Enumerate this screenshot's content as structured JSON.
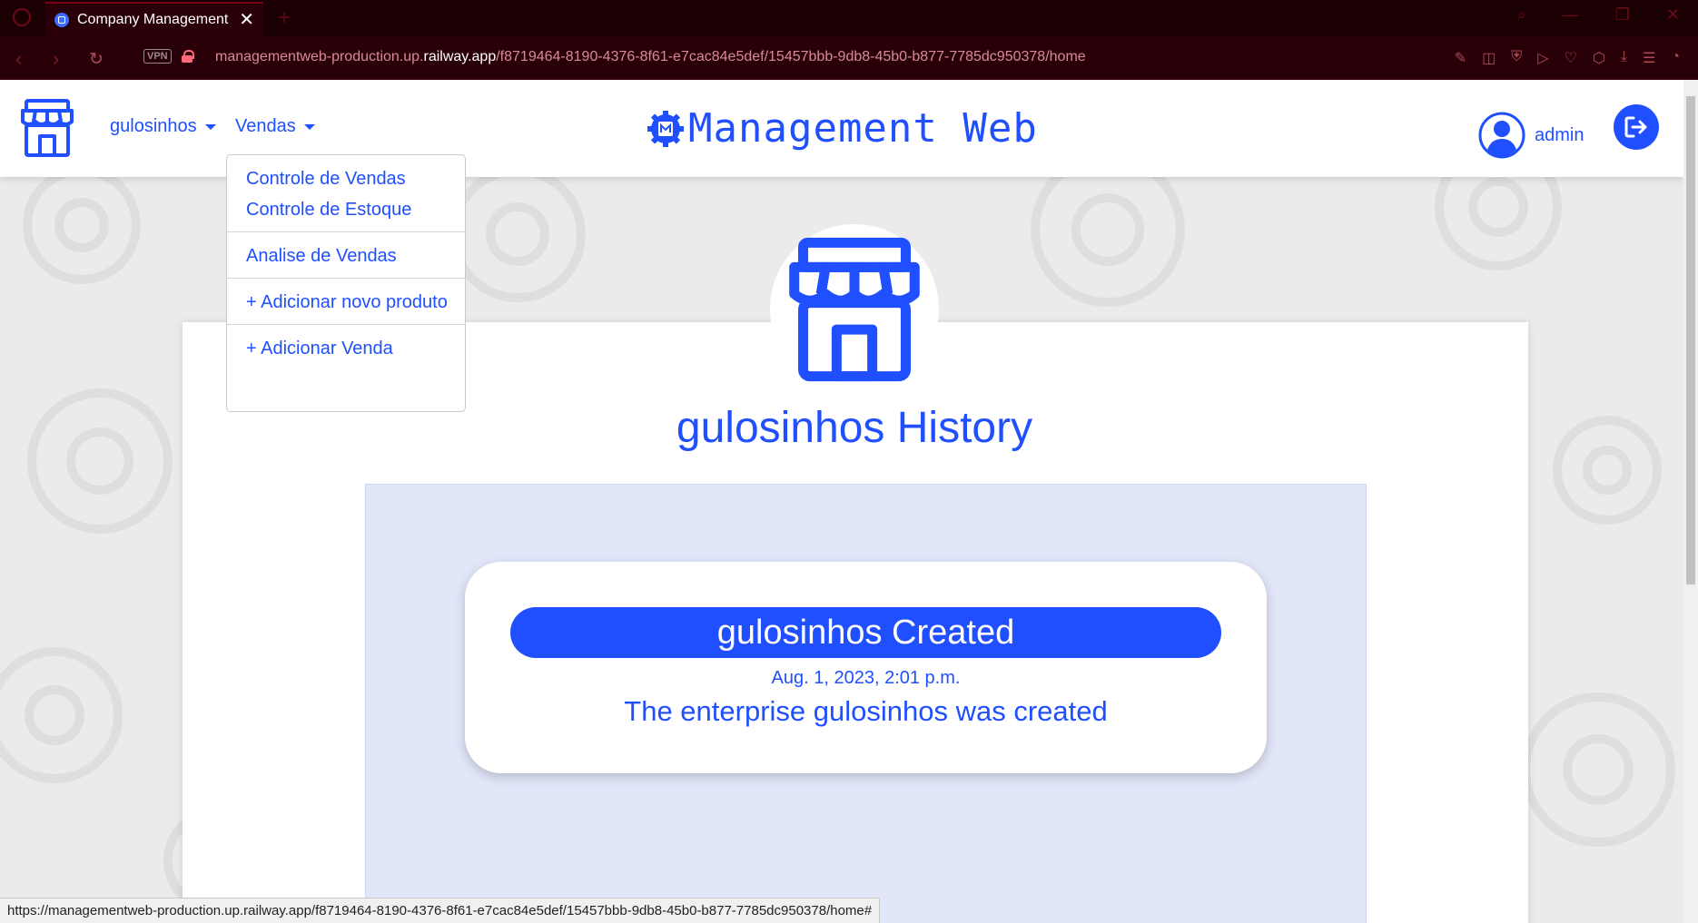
{
  "browser": {
    "tab_title": "Company Management",
    "url_prefix": "managementweb-production.up.",
    "url_host": "railway.app",
    "url_path": "/f8719464-8190-4376-8f61-e7cac84e5def/15457bbb-9db8-45b0-b877-7785dc950378/home",
    "vpn_label": "VPN",
    "status_url": "https://managementweb-production.up.railway.app/f8719464-8190-4376-8f61-e7cac84e5def/15457bbb-9db8-45b0-b877-7785dc950378/home#"
  },
  "navbar": {
    "company_menu": "gulosinhos",
    "sales_menu": "Vendas",
    "site_title": "Management Web",
    "username": "admin"
  },
  "dropdown": {
    "items": [
      "Controle de Vendas",
      "Controle de Estoque",
      "Analise de Vendas",
      "+ Adicionar novo produto",
      "+ Adicionar Venda"
    ]
  },
  "main": {
    "history_title": "gulosinhos History",
    "events": [
      {
        "title": "gulosinhos Created",
        "date": "Aug. 1, 2023, 2:01 p.m.",
        "description": "The enterprise gulosinhos was created"
      }
    ]
  },
  "colors": {
    "accent": "#1f4fff",
    "chrome_bg": "#2a0008",
    "timeline_bg": "#e1e6f9"
  }
}
